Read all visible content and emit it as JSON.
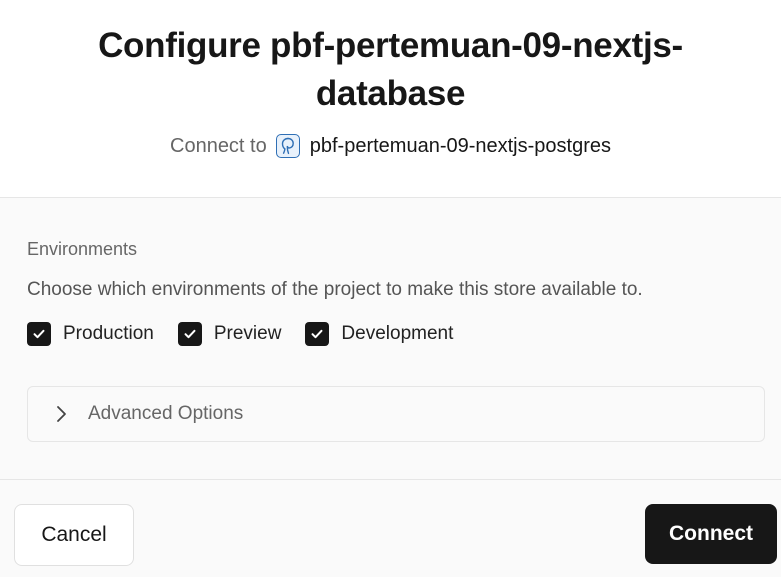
{
  "dialog": {
    "title": "Configure pbf-pertemuan-09-nextjs-database",
    "connect_prefix": "Connect to",
    "connect_target": "pbf-pertemuan-09-nextjs-postgres",
    "connect_icon": "postgres-elephant-icon"
  },
  "environments": {
    "label": "Environments",
    "description": "Choose which environments of the project to make this store available to.",
    "options": [
      {
        "label": "Production",
        "checked": true
      },
      {
        "label": "Preview",
        "checked": true
      },
      {
        "label": "Development",
        "checked": true
      }
    ]
  },
  "advanced": {
    "label": "Advanced Options",
    "expanded": false
  },
  "footer": {
    "cancel_label": "Cancel",
    "connect_label": "Connect"
  },
  "colors": {
    "primary": "#171717",
    "accent_icon": "#2f6fb5",
    "muted_text": "#666666",
    "background": "#fafafa"
  }
}
